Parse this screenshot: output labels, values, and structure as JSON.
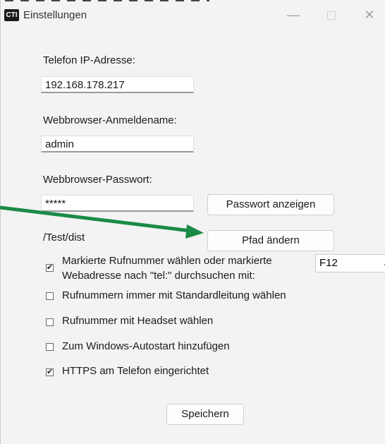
{
  "window": {
    "title": "Einstellungen",
    "app_icon_text": "CTI",
    "minimize_glyph": "—",
    "close_glyph": "✕"
  },
  "fields": {
    "ip_label": "Telefon IP-Adresse:",
    "ip_value": "192.168.178.217",
    "user_label": "Webbrowser-Anmeldename:",
    "user_value": "admin",
    "password_label": "Webbrowser-Passwort:",
    "password_value": "*****"
  },
  "buttons": {
    "show_password": "Passwort anzeigen",
    "change_path": "Pfad ändern",
    "save": "Speichern"
  },
  "path_text": "/Test/dist",
  "options": {
    "dial_selected_line1": "Markierte Rufnummer wählen oder markierte",
    "dial_selected_line2": "Webadresse nach \"tel:\" durchsuchen mit:",
    "hotkey_value": "F12",
    "standard_line": "Rufnummern immer mit Standardleitung wählen",
    "headset": "Rufnummer mit Headset wählen",
    "autostart": "Zum Windows-Autostart hinzufügen",
    "https": "HTTPS am Telefon eingerichtet"
  },
  "checkbox_states": {
    "dial_selected": true,
    "standard_line": false,
    "headset": false,
    "autostart": false,
    "https": true
  },
  "colors": {
    "annotation_arrow": "#1a8a46",
    "window_bg": "#f3f3f3"
  }
}
